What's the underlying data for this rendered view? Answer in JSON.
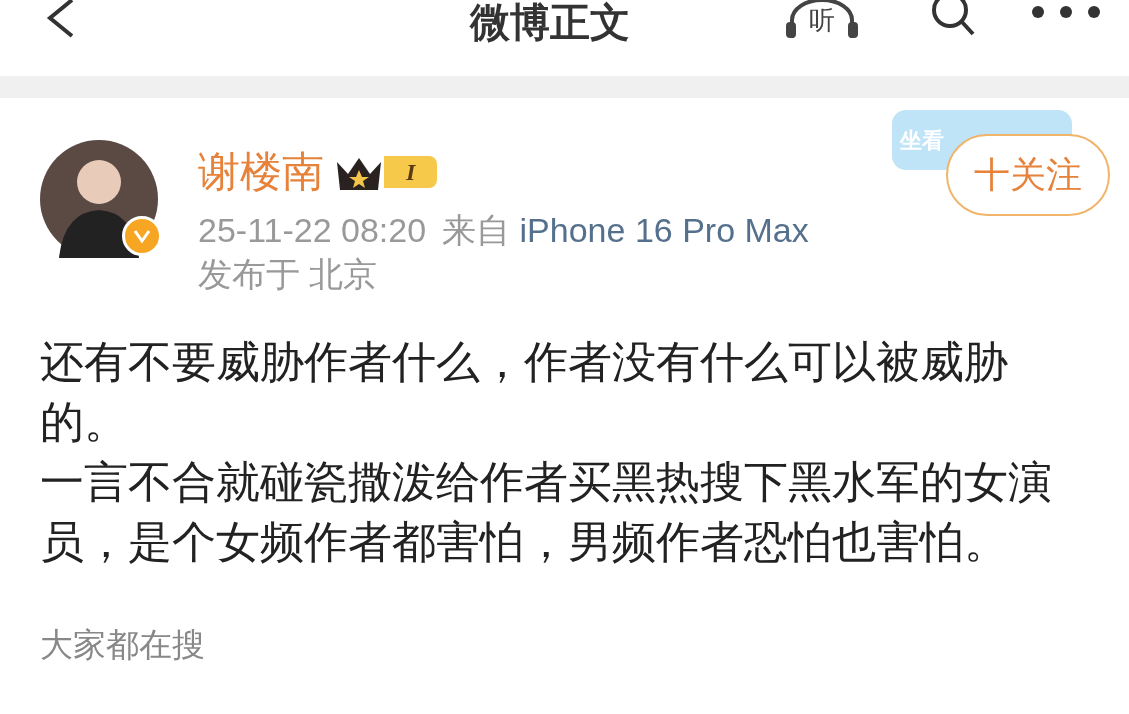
{
  "header": {
    "title": "微博正文",
    "listen_label": "听"
  },
  "post": {
    "author": "谢楼南",
    "vip_level": "I",
    "sticker_text": "坐看",
    "follow_button": "十关注",
    "time": "25-11-22 08:20",
    "source_prefix": "来自",
    "source": "iPhone 16 Pro Max",
    "location": "发布于 北京",
    "paragraphs": [
      "还有不要威胁作者什么，作者没有什么可以被威胁的。",
      "一言不合就碰瓷撒泼给作者买黑热搜下黑水军的女演员，是个女频作者都害怕，男频作者恐怕也害怕。"
    ]
  },
  "trending": {
    "title": "大家都在搜"
  }
}
